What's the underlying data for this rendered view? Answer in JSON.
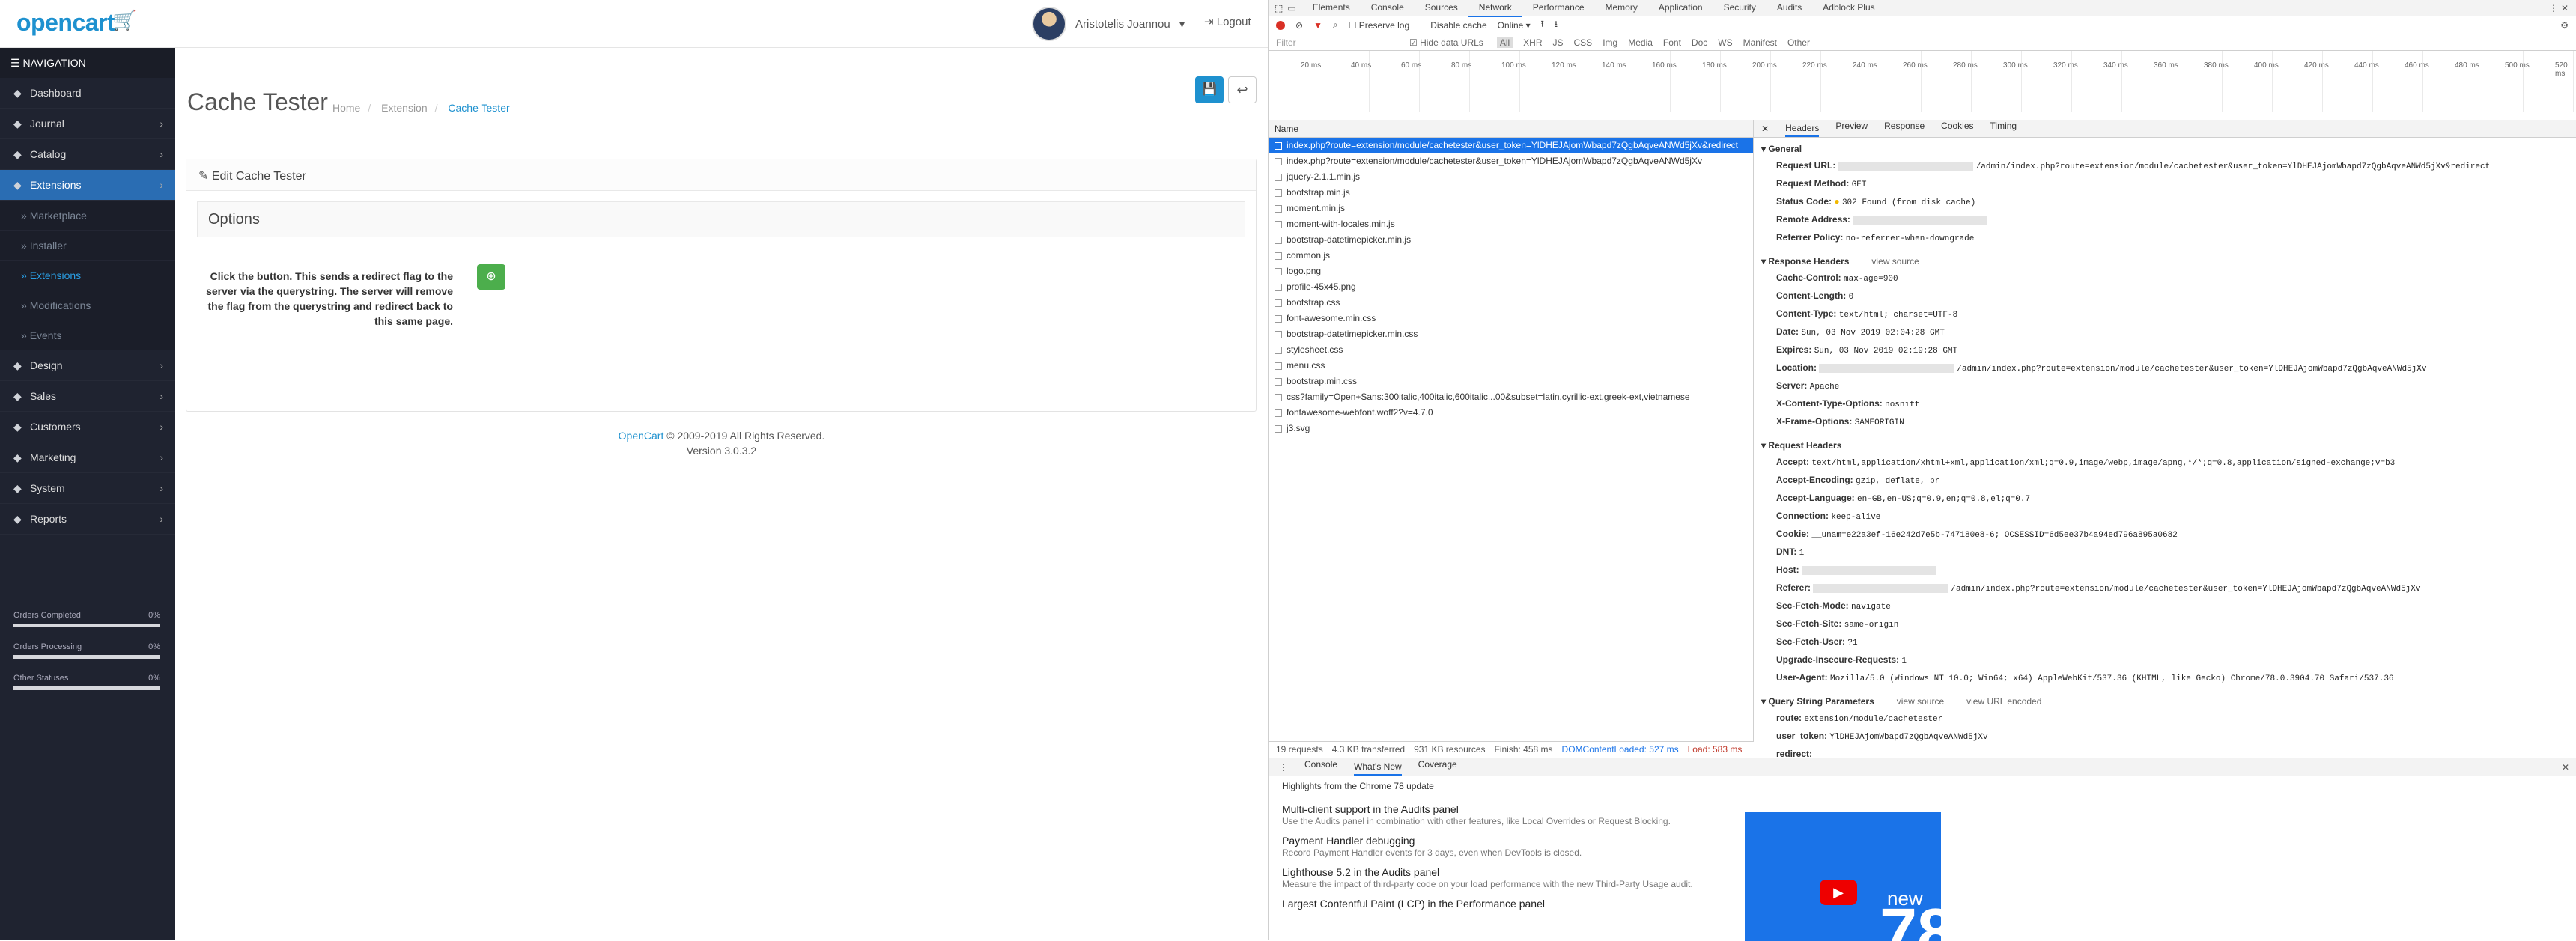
{
  "opencart": {
    "logo": "opencart",
    "user_name": "Aristotelis Joannou",
    "logout": "Logout",
    "nav_title": "NAVIGATION",
    "nav": [
      {
        "label": "Dashboard",
        "icon": "dashboard-icon",
        "chev": false
      },
      {
        "label": "Journal",
        "icon": "journal-icon",
        "chev": true
      },
      {
        "label": "Catalog",
        "icon": "tags-icon",
        "chev": true
      },
      {
        "label": "Extensions",
        "icon": "puzzle-icon",
        "chev": true,
        "active": true
      },
      {
        "label": "Design",
        "icon": "monitor-icon",
        "chev": true
      },
      {
        "label": "Sales",
        "icon": "cart-icon",
        "chev": true
      },
      {
        "label": "Customers",
        "icon": "user-icon",
        "chev": true
      },
      {
        "label": "Marketing",
        "icon": "share-icon",
        "chev": true
      },
      {
        "label": "System",
        "icon": "cog-icon",
        "chev": true
      },
      {
        "label": "Reports",
        "icon": "bar-chart-icon",
        "chev": true
      }
    ],
    "sub": [
      "Marketplace",
      "Installer",
      "Extensions",
      "Modifications",
      "Events"
    ],
    "stats": [
      {
        "label": "Orders Completed",
        "percent": "0%"
      },
      {
        "label": "Orders Processing",
        "percent": "0%"
      },
      {
        "label": "Other Statuses",
        "percent": "0%"
      }
    ],
    "page_title": "Cache Tester",
    "breadcrumbs": [
      "Home",
      "Extension",
      "Cache Tester"
    ],
    "panel_title": "Edit Cache Tester",
    "fieldset": "Options",
    "description": "Click the button. This sends a redirect flag to the server via the querystring. The server will remove the flag from the querystring and redirect back to this same page.",
    "footer_link": "OpenCart",
    "footer_text": "© 2009-2019 All Rights Reserved.",
    "version": "Version 3.0.3.2"
  },
  "devtools": {
    "tabs": [
      "Elements",
      "Console",
      "Sources",
      "Network",
      "Performance",
      "Memory",
      "Application",
      "Security",
      "Audits",
      "Adblock Plus"
    ],
    "preserve_log": "Preserve log",
    "disable_cache": "Disable cache",
    "throttle": "Online",
    "filter_placeholder": "Filter",
    "hide_data_urls": "Hide data URLs",
    "types": [
      "All",
      "XHR",
      "JS",
      "CSS",
      "Img",
      "Media",
      "Font",
      "Doc",
      "WS",
      "Manifest",
      "Other"
    ],
    "ticks": [
      "20 ms",
      "40 ms",
      "60 ms",
      "80 ms",
      "100 ms",
      "120 ms",
      "140 ms",
      "160 ms",
      "180 ms",
      "200 ms",
      "220 ms",
      "240 ms",
      "260 ms",
      "280 ms",
      "300 ms",
      "320 ms",
      "340 ms",
      "360 ms",
      "380 ms",
      "400 ms",
      "420 ms",
      "440 ms",
      "460 ms",
      "480 ms",
      "500 ms",
      "520 ms"
    ],
    "name_col": "Name",
    "requests": [
      "index.php?route=extension/module/cachetester&user_token=YlDHEJAjomWbapd7zQgbAqveANWd5jXv&redirect",
      "index.php?route=extension/module/cachetester&user_token=YlDHEJAjomWbapd7zQgbAqveANWd5jXv",
      "jquery-2.1.1.min.js",
      "bootstrap.min.js",
      "moment.min.js",
      "moment-with-locales.min.js",
      "bootstrap-datetimepicker.min.js",
      "common.js",
      "logo.png",
      "profile-45x45.png",
      "bootstrap.css",
      "font-awesome.min.css",
      "bootstrap-datetimepicker.min.css",
      "stylesheet.css",
      "menu.css",
      "bootstrap.min.css",
      "css?family=Open+Sans:300italic,400italic,600italic...00&subset=latin,cyrillic-ext,greek-ext,vietnamese",
      "fontawesome-webfont.woff2?v=4.7.0",
      "j3.svg"
    ],
    "detail_tabs": [
      "Headers",
      "Preview",
      "Response",
      "Cookies",
      "Timing"
    ],
    "general_title": "General",
    "general": [
      {
        "k": "Request URL:",
        "v": "/admin/index.php?route=extension/module/cachetester&user_token=YlDHEJAjomWbapd7zQgbAqveANWd5jXv&redirect",
        "blur": true
      },
      {
        "k": "Request Method:",
        "v": "GET"
      },
      {
        "k": "Status Code:",
        "v": "302 Found (from disk cache)",
        "dot": true
      },
      {
        "k": "Remote Address:",
        "v": "",
        "blur": true
      },
      {
        "k": "Referrer Policy:",
        "v": "no-referrer-when-downgrade"
      }
    ],
    "response_title": "Response Headers",
    "view_source": "view source",
    "view_url_encoded": "view URL encoded",
    "response": [
      {
        "k": "Cache-Control:",
        "v": "max-age=900"
      },
      {
        "k": "Content-Length:",
        "v": "0"
      },
      {
        "k": "Content-Type:",
        "v": "text/html; charset=UTF-8"
      },
      {
        "k": "Date:",
        "v": "Sun, 03 Nov 2019 02:04:28 GMT"
      },
      {
        "k": "Expires:",
        "v": "Sun, 03 Nov 2019 02:19:28 GMT"
      },
      {
        "k": "Location:",
        "v": "/admin/index.php?route=extension/module/cachetester&user_token=YlDHEJAjomWbapd7zQgbAqveANWd5jXv",
        "blur": true
      },
      {
        "k": "Server:",
        "v": "Apache"
      },
      {
        "k": "X-Content-Type-Options:",
        "v": "nosniff"
      },
      {
        "k": "X-Frame-Options:",
        "v": "SAMEORIGIN"
      }
    ],
    "request_title": "Request Headers",
    "request": [
      {
        "k": "Accept:",
        "v": "text/html,application/xhtml+xml,application/xml;q=0.9,image/webp,image/apng,*/*;q=0.8,application/signed-exchange;v=b3"
      },
      {
        "k": "Accept-Encoding:",
        "v": "gzip, deflate, br"
      },
      {
        "k": "Accept-Language:",
        "v": "en-GB,en-US;q=0.9,en;q=0.8,el;q=0.7"
      },
      {
        "k": "Connection:",
        "v": "keep-alive"
      },
      {
        "k": "Cookie:",
        "v": "__unam=e22a3ef-16e242d7e5b-747180e8-6; OCSESSID=6d5ee37b4a94ed796a895a0682"
      },
      {
        "k": "DNT:",
        "v": "1"
      },
      {
        "k": "Host:",
        "v": "",
        "blur": true
      },
      {
        "k": "Referer:",
        "v": "/admin/index.php?route=extension/module/cachetester&user_token=YlDHEJAjomWbapd7zQgbAqveANWd5jXv",
        "blur": true
      },
      {
        "k": "Sec-Fetch-Mode:",
        "v": "navigate"
      },
      {
        "k": "Sec-Fetch-Site:",
        "v": "same-origin"
      },
      {
        "k": "Sec-Fetch-User:",
        "v": "?1"
      },
      {
        "k": "Upgrade-Insecure-Requests:",
        "v": "1"
      },
      {
        "k": "User-Agent:",
        "v": "Mozilla/5.0 (Windows NT 10.0; Win64; x64) AppleWebKit/537.36 (KHTML, like Gecko) Chrome/78.0.3904.70 Safari/537.36"
      }
    ],
    "query_title": "Query String Parameters",
    "query": [
      {
        "k": "route:",
        "v": "extension/module/cachetester"
      },
      {
        "k": "user_token:",
        "v": "YlDHEJAjomWbapd7zQgbAqveANWd5jXv"
      },
      {
        "k": "redirect:",
        "v": ""
      }
    ],
    "status": {
      "requests": "19 requests",
      "transferred": "4.3 KB transferred",
      "resources": "931 KB resources",
      "finish": "Finish: 458 ms",
      "dcl": "DOMContentLoaded: 527 ms",
      "load": "Load: 583 ms"
    },
    "drawer_tabs": [
      "Console",
      "What's New",
      "Coverage"
    ],
    "highlights": "Highlights from the Chrome 78 update",
    "features": [
      {
        "t": "Multi-client support in the Audits panel",
        "d": "Use the Audits panel in combination with other features, like Local Overrides or Request Blocking."
      },
      {
        "t": "Payment Handler debugging",
        "d": "Record Payment Handler events for 3 days, even when DevTools is closed."
      },
      {
        "t": "Lighthouse 5.2 in the Audits panel",
        "d": "Measure the impact of third-party code on your load performance with the new Third-Party Usage audit."
      },
      {
        "t": "Largest Contentful Paint (LCP) in the Performance panel",
        "d": ""
      }
    ],
    "thumb_new": "new",
    "thumb_num": "78"
  }
}
